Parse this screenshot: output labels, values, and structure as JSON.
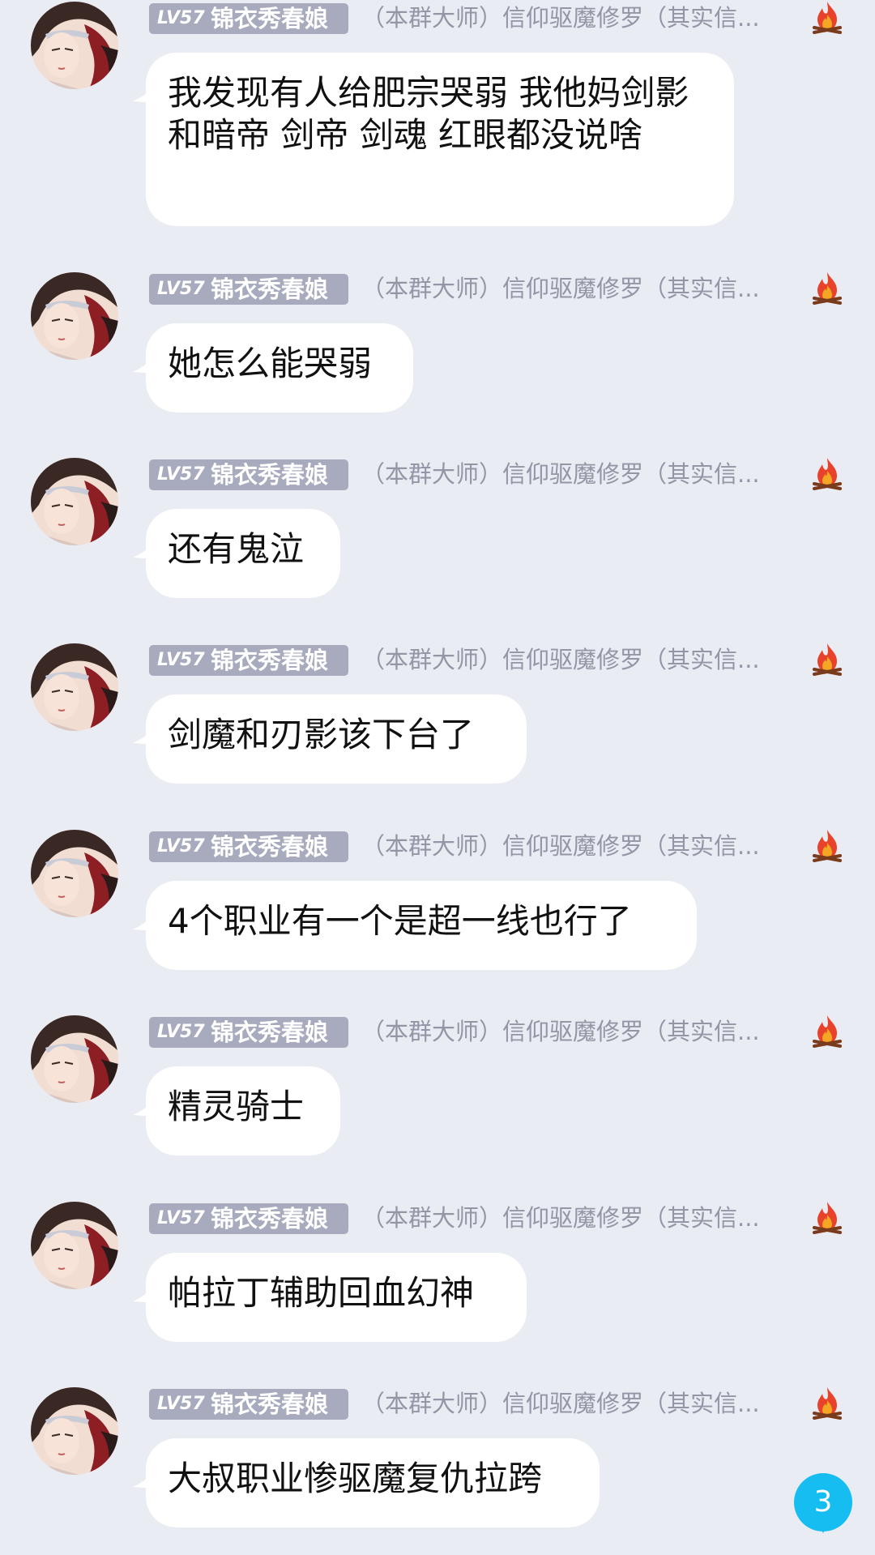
{
  "sender": {
    "level": "LV57",
    "nickname": "锦衣秀春娘",
    "title": "（本群大师）信仰驱魔修罗（其实信...",
    "badge_icon": "fire-icon"
  },
  "messages": [
    {
      "text": "我发现有人给肥宗哭弱 我他妈剑影和暗帝 剑帝 剑魂 红眼都没说啥"
    },
    {
      "text": "她怎么能哭弱"
    },
    {
      "text": "还有鬼泣"
    },
    {
      "text": "剑魔和刃影该下台了"
    },
    {
      "text": "4个职业有一个是超一线也行了"
    },
    {
      "text": "精灵骑士"
    },
    {
      "text": "帕拉丁辅助回血幻神"
    },
    {
      "text": "大叔职业惨驱魔复仇拉跨"
    }
  ],
  "unread_count": "3",
  "colors": {
    "background": "#eaecf3",
    "bubble": "#ffffff",
    "level_badge": "#a7abbd",
    "unread_badge": "#16bdf0"
  }
}
